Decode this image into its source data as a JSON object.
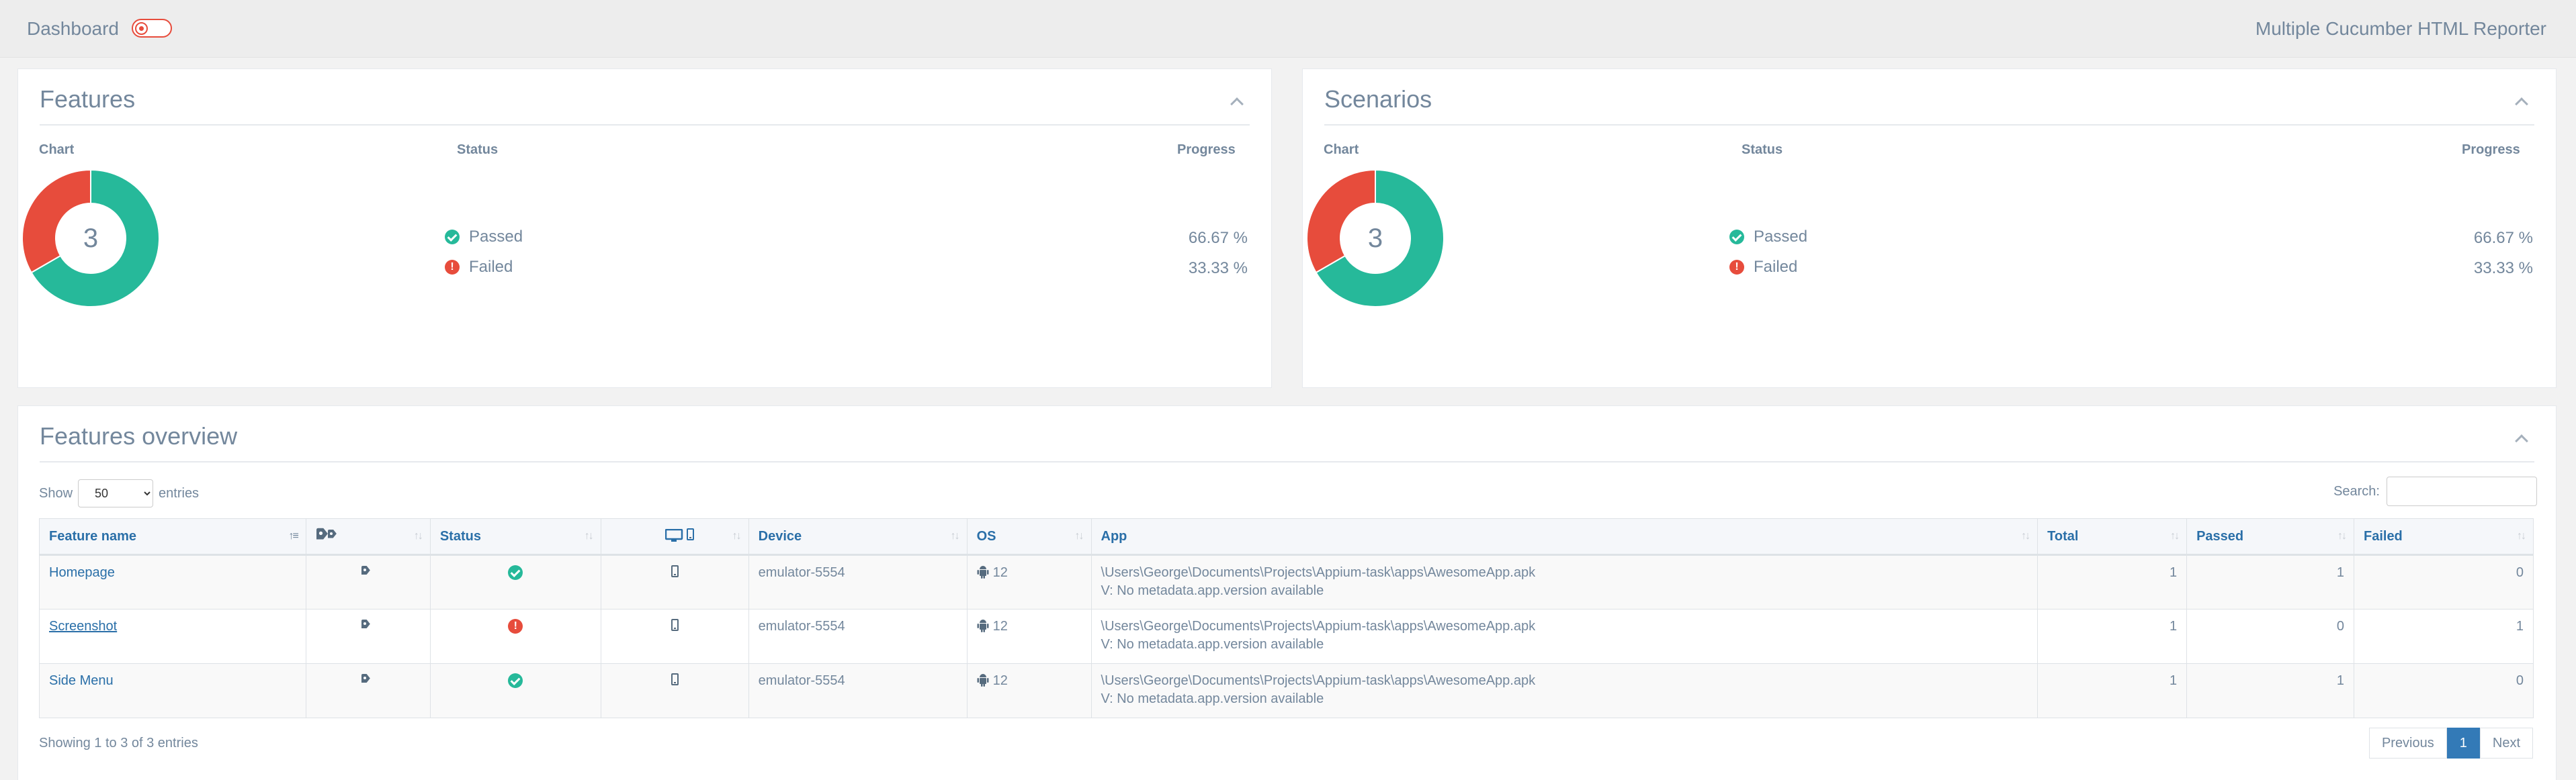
{
  "topbar": {
    "title": "Dashboard",
    "brand": "Multiple Cucumber HTML Reporter"
  },
  "features_panel": {
    "title": "Features",
    "col_chart": "Chart",
    "col_status": "Status",
    "col_progress": "Progress",
    "total": "3",
    "rows": [
      {
        "label": "Passed",
        "pct": "66.67 %"
      },
      {
        "label": "Failed",
        "pct": "33.33 %"
      }
    ]
  },
  "scenarios_panel": {
    "title": "Scenarios",
    "col_chart": "Chart",
    "col_status": "Status",
    "col_progress": "Progress",
    "total": "3",
    "rows": [
      {
        "label": "Passed",
        "pct": "66.67 %"
      },
      {
        "label": "Failed",
        "pct": "33.33 %"
      }
    ]
  },
  "chart_data": [
    {
      "type": "pie",
      "categories": [
        "Passed",
        "Failed"
      ],
      "values": [
        2,
        1
      ],
      "title": "Features",
      "colors": [
        "#26b99a",
        "#e74c3c"
      ]
    },
    {
      "type": "pie",
      "categories": [
        "Passed",
        "Failed"
      ],
      "values": [
        2,
        1
      ],
      "title": "Scenarios",
      "colors": [
        "#26b99a",
        "#e74c3c"
      ]
    }
  ],
  "overview": {
    "title": "Features overview",
    "show_label": "Show",
    "entries_label": "entries",
    "page_size": "50",
    "search_label": "Search:",
    "columns": [
      "Feature name",
      "",
      "Status",
      "",
      "Device",
      "OS",
      "App",
      "Total",
      "Passed",
      "Failed"
    ],
    "rows": [
      {
        "name": "Homepage",
        "status": "passed",
        "device": "emulator-5554",
        "os": "12",
        "app": "\\Users\\George\\Documents\\Projects\\Appium-task\\apps\\AwesomeApp.apk",
        "version": "V: No metadata.app.version available",
        "total": "1",
        "passed": "1",
        "failed": "0"
      },
      {
        "name": "Screenshot",
        "status": "failed",
        "device": "emulator-5554",
        "os": "12",
        "app": "\\Users\\George\\Documents\\Projects\\Appium-task\\apps\\AwesomeApp.apk",
        "version": "V: No metadata.app.version available",
        "total": "1",
        "passed": "0",
        "failed": "1"
      },
      {
        "name": "Side Menu",
        "status": "passed",
        "device": "emulator-5554",
        "os": "12",
        "app": "\\Users\\George\\Documents\\Projects\\Appium-task\\apps\\AwesomeApp.apk",
        "version": "V: No metadata.app.version available",
        "total": "1",
        "passed": "1",
        "failed": "0"
      }
    ],
    "info": "Showing 1 to 3 of 3 entries",
    "pager": {
      "prev": "Previous",
      "page": "1",
      "next": "Next"
    }
  },
  "colors": {
    "passed": "#26b99a",
    "failed": "#e74c3c",
    "link": "#2a6fa8",
    "text": "#73879c"
  }
}
